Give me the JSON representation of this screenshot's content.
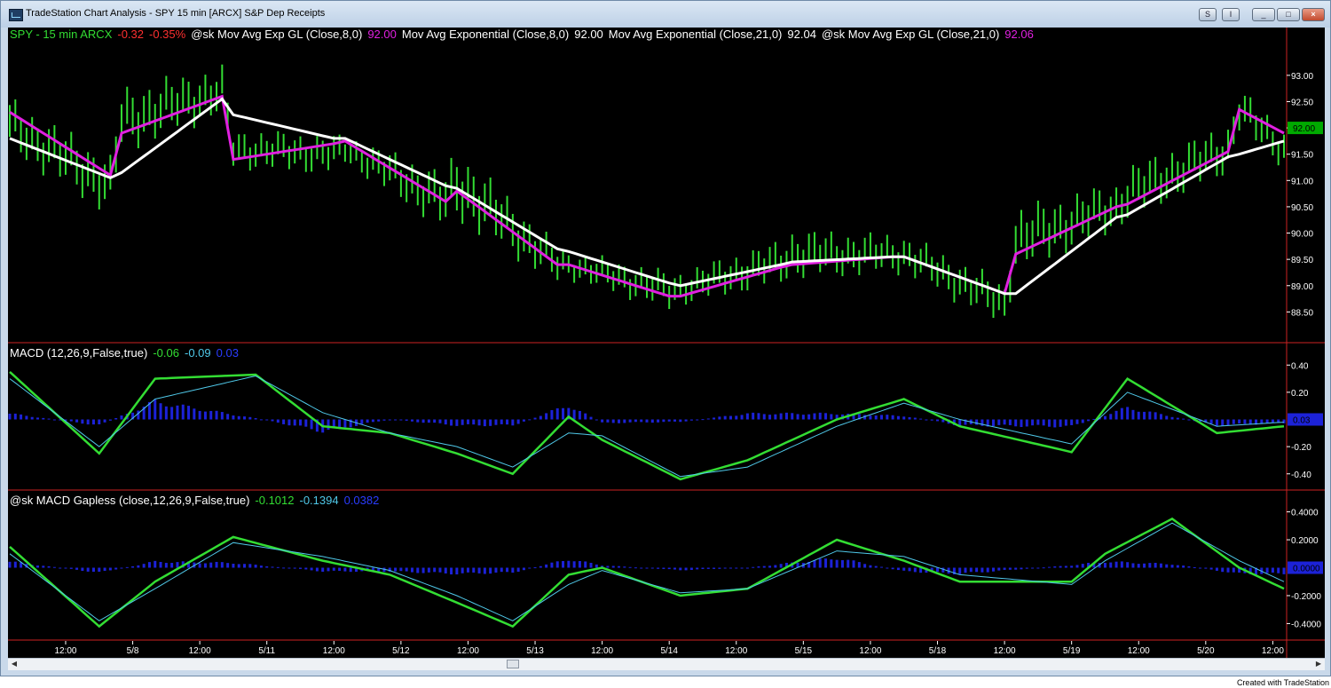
{
  "window": {
    "title": "TradeStation Chart Analysis - SPY 15 min [ARCX] S&P Dep Receipts",
    "buttons": [
      "S",
      "I",
      "_",
      "□",
      "×"
    ]
  },
  "colors": {
    "background": "#000000",
    "price_bars": "#33dd33",
    "ema_gl": "#e020e0",
    "ema": "#ffffff",
    "macd_line": "#33dd33",
    "signal_line": "#4fc8e8",
    "histogram": "#1c22d8",
    "panel_divider": "#cc2222",
    "axis_text": "#ffffff",
    "price_marker_bg": "#00aa00"
  },
  "legends": {
    "price": [
      {
        "text": "SPY - 15 min  ARCX",
        "color": "#33dd33"
      },
      {
        "text": "-0.32",
        "color": "#ff3030"
      },
      {
        "text": "-0.35%",
        "color": "#ff3030"
      },
      {
        "text": "@sk  Mov Avg Exp GL (Close,8,0)",
        "color": "#ffffff"
      },
      {
        "text": "92.00",
        "color": "#e020e0"
      },
      {
        "text": "Mov Avg Exponential (Close,8,0)",
        "color": "#ffffff"
      },
      {
        "text": "92.00",
        "color": "#ffffff"
      },
      {
        "text": "Mov Avg Exponential (Close,21,0)",
        "color": "#ffffff"
      },
      {
        "text": "92.04",
        "color": "#ffffff"
      },
      {
        "text": "@sk  Mov Avg Exp GL (Close,21,0)",
        "color": "#ffffff"
      },
      {
        "text": "92.06",
        "color": "#e020e0"
      }
    ],
    "macd": [
      {
        "text": "MACD (12,26,9,False,true)",
        "color": "#ffffff"
      },
      {
        "text": "-0.06",
        "color": "#33dd33"
      },
      {
        "text": "-0.09",
        "color": "#4fc8e8"
      },
      {
        "text": "0.03",
        "color": "#2a3cff"
      }
    ],
    "macd_gapless": [
      {
        "text": "@sk  MACD  Gapless (close,12,26,9,False,true)",
        "color": "#ffffff"
      },
      {
        "text": "-0.1012",
        "color": "#33dd33"
      },
      {
        "text": "-0.1394",
        "color": "#4fc8e8"
      },
      {
        "text": "0.0382",
        "color": "#2a3cff"
      }
    ]
  },
  "chart_data": [
    {
      "type": "line",
      "title": "SPY - 15 min ARCX",
      "ylim": [
        88.0,
        93.2
      ],
      "y_ticks": [
        "93.00",
        "92.50",
        "92.00",
        "91.50",
        "91.00",
        "90.50",
        "90.00",
        "89.50",
        "89.00",
        "88.50"
      ],
      "y_tick_values": [
        93.0,
        92.5,
        92.0,
        91.5,
        91.0,
        90.5,
        90.0,
        89.5,
        89.0,
        88.5
      ],
      "last_price_marker": "92.00",
      "last_price_value": 92.0,
      "x": [
        0,
        9,
        10,
        19,
        20,
        29,
        30,
        39,
        40,
        49,
        50,
        59,
        60,
        69,
        70,
        79,
        80,
        89,
        90,
        99,
        100,
        109,
        110,
        114
      ],
      "series": [
        {
          "name": "@sk Mov Avg Exp GL (Close,8,0)",
          "color": "#e020e0",
          "values": [
            92.3,
            91.1,
            91.9,
            92.6,
            91.4,
            91.7,
            91.75,
            90.6,
            90.8,
            89.4,
            89.4,
            88.8,
            88.8,
            89.35,
            89.4,
            89.55,
            89.55,
            88.85,
            89.6,
            90.5,
            90.55,
            91.55,
            92.35,
            91.9
          ]
        },
        {
          "name": "Mov Avg Exponential (Close,21,0)",
          "color": "#ffffff",
          "values": [
            91.8,
            91.05,
            91.15,
            92.55,
            92.25,
            91.8,
            91.8,
            90.9,
            90.85,
            89.7,
            89.65,
            89.05,
            89.0,
            89.4,
            89.45,
            89.55,
            89.55,
            88.85,
            88.85,
            90.3,
            90.35,
            91.45,
            91.5,
            91.75
          ]
        }
      ],
      "price_bars": {
        "low": [
          91.5,
          90.3,
          91.5,
          92.2,
          91.2,
          91.1,
          91.3,
          90.0,
          90.2,
          89.0,
          89.1,
          88.5,
          88.6,
          89.0,
          89.1,
          89.2,
          89.2,
          88.2,
          89.2,
          90.0,
          90.2,
          91.1,
          91.9,
          91.2
        ],
        "high": [
          92.6,
          91.5,
          92.8,
          93.2,
          92.0,
          91.9,
          91.9,
          91.2,
          91.7,
          89.8,
          89.7,
          89.3,
          89.3,
          89.9,
          90.1,
          90.0,
          90.0,
          89.1,
          90.5,
          91.0,
          91.3,
          92.1,
          92.8,
          92.0
        ]
      }
    },
    {
      "type": "line",
      "title": "MACD (12,26,9,False,true)",
      "ylim": [
        -0.48,
        0.48
      ],
      "y_ticks": [
        "0.40",
        "0.20",
        "-0.20",
        "-0.40"
      ],
      "y_tick_values": [
        0.4,
        0.2,
        -0.2,
        -0.4
      ],
      "last_value_marker": "0.03",
      "x": [
        0,
        8,
        13,
        22,
        28,
        34,
        40,
        45,
        50,
        53,
        60,
        66,
        74,
        80,
        85,
        95,
        100,
        108,
        114
      ],
      "series": [
        {
          "name": "MACD",
          "color": "#33dd33",
          "values": [
            0.35,
            -0.25,
            0.3,
            0.33,
            -0.05,
            -0.1,
            -0.25,
            -0.4,
            0.02,
            -0.15,
            -0.44,
            -0.3,
            0.0,
            0.15,
            -0.05,
            -0.24,
            0.3,
            -0.1,
            -0.05
          ]
        },
        {
          "name": "Signal",
          "color": "#4fc8e8",
          "values": [
            0.3,
            -0.2,
            0.15,
            0.32,
            0.05,
            -0.1,
            -0.2,
            -0.35,
            -0.1,
            -0.12,
            -0.42,
            -0.35,
            -0.05,
            0.12,
            0.0,
            -0.18,
            0.2,
            -0.05,
            -0.02
          ]
        },
        {
          "name": "Histogram",
          "color": "#1c22d8",
          "values": [
            0.05,
            -0.05,
            0.15,
            0.01,
            -0.1,
            0.0,
            -0.05,
            -0.05,
            0.12,
            -0.03,
            -0.02,
            0.05,
            0.05,
            0.03,
            -0.05,
            -0.06,
            0.1,
            -0.05,
            -0.03
          ]
        }
      ]
    },
    {
      "type": "line",
      "title": "@sk MACD Gapless (close,12,26,9,False,true)",
      "ylim": [
        -0.48,
        0.48
      ],
      "y_ticks": [
        "0.4000",
        "0.2000",
        "-0.2000",
        "-0.4000"
      ],
      "y_tick_values": [
        0.4,
        0.2,
        -0.2,
        -0.4
      ],
      "last_value_marker": "0.0000",
      "x": [
        0,
        8,
        13,
        20,
        28,
        34,
        40,
        45,
        50,
        53,
        60,
        66,
        74,
        80,
        85,
        95,
        98,
        104,
        110,
        114
      ],
      "series": [
        {
          "name": "MACD",
          "color": "#33dd33",
          "values": [
            0.15,
            -0.42,
            -0.1,
            0.22,
            0.05,
            -0.05,
            -0.25,
            -0.42,
            -0.05,
            0.0,
            -0.2,
            -0.15,
            0.2,
            0.05,
            -0.1,
            -0.1,
            0.1,
            0.35,
            0.0,
            -0.15
          ]
        },
        {
          "name": "Signal",
          "color": "#4fc8e8",
          "values": [
            0.1,
            -0.38,
            -0.15,
            0.18,
            0.08,
            -0.02,
            -0.2,
            -0.38,
            -0.12,
            -0.02,
            -0.18,
            -0.15,
            0.12,
            0.08,
            -0.05,
            -0.12,
            0.05,
            0.32,
            0.05,
            -0.1
          ]
        },
        {
          "name": "Histogram",
          "color": "#1c22d8",
          "values": [
            0.05,
            -0.04,
            0.05,
            0.04,
            -0.03,
            -0.03,
            -0.05,
            -0.04,
            0.07,
            0.02,
            -0.02,
            0.0,
            0.08,
            -0.03,
            -0.05,
            0.02,
            0.05,
            0.03,
            -0.05,
            -0.05
          ]
        }
      ]
    }
  ],
  "x_axis": {
    "labels": [
      "12:00",
      "5/8",
      "12:00",
      "5/11",
      "12:00",
      "5/12",
      "12:00",
      "5/13",
      "12:00",
      "5/14",
      "12:00",
      "5/15",
      "12:00",
      "5/18",
      "12:00",
      "5/19",
      "12:00",
      "5/20",
      "12:00"
    ],
    "positions": [
      5,
      11,
      17,
      23,
      29,
      35,
      41,
      47,
      53,
      59,
      65,
      71,
      77,
      83,
      89,
      95,
      101,
      107,
      113
    ]
  },
  "footer": "Created with TradeStation"
}
